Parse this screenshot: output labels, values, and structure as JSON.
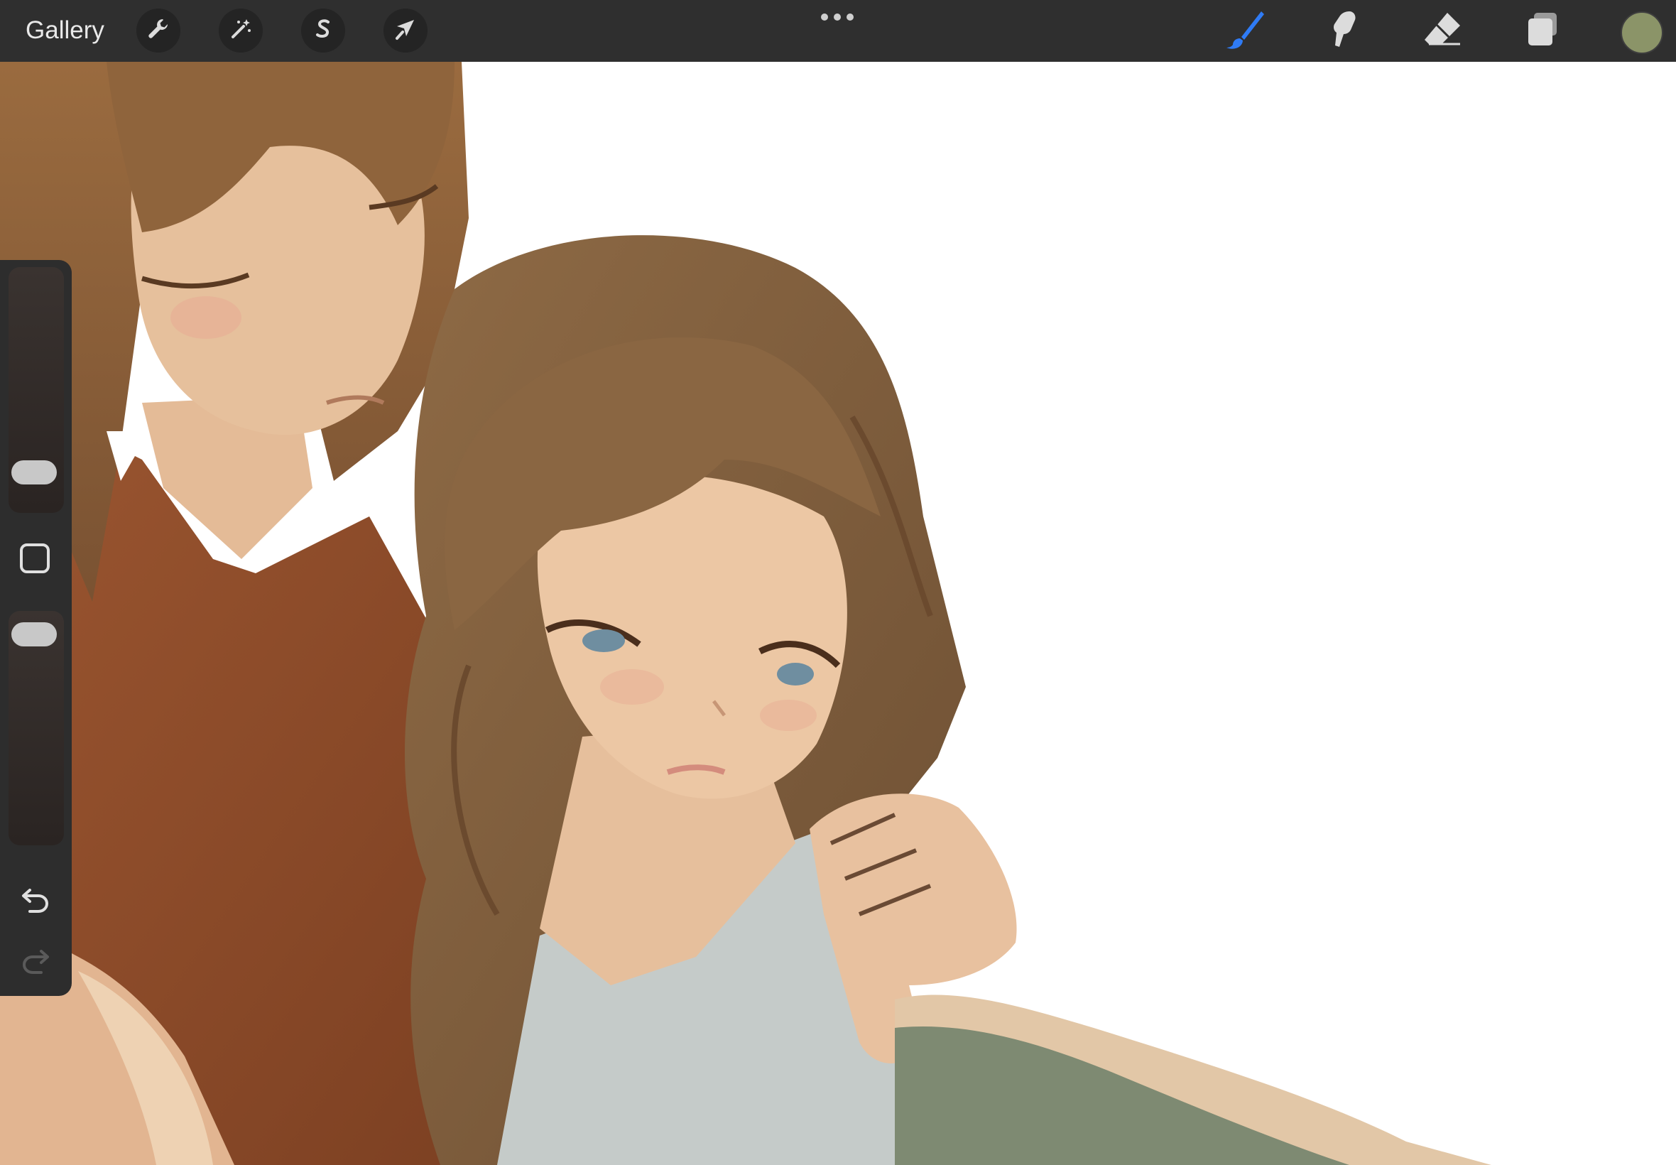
{
  "topbar": {
    "gallery_label": "Gallery",
    "left_tools": [
      {
        "name": "actions",
        "icon": "wrench-icon"
      },
      {
        "name": "adjustments",
        "icon": "magic-wand-icon"
      },
      {
        "name": "selection",
        "icon": "selection-s-icon"
      },
      {
        "name": "transform",
        "icon": "arrow-cursor-icon"
      }
    ],
    "more_icon": "more-dots-icon",
    "right_tools": [
      {
        "name": "brush",
        "icon": "brush-icon",
        "active": true
      },
      {
        "name": "smudge",
        "icon": "smudge-icon",
        "active": false
      },
      {
        "name": "eraser",
        "icon": "eraser-icon",
        "active": false
      },
      {
        "name": "layers",
        "icon": "layers-icon",
        "active": false
      }
    ],
    "current_color": "#8b9468"
  },
  "sidebar": {
    "brush_size_level": 0.12,
    "opacity_level": 0.96,
    "modify_icon": "square-modify-icon",
    "undo_icon": "undo-icon",
    "redo_icon": "redo-icon",
    "redo_enabled": false
  },
  "colors": {
    "accent": "#2f7bf5",
    "toolbar_bg": "#2f2f2f",
    "hair": "#8a5f36",
    "sweater": "#8b4a28",
    "skin": "#e9c6a3",
    "top": "#c5cbc9",
    "blanket": "#7e8a72"
  }
}
